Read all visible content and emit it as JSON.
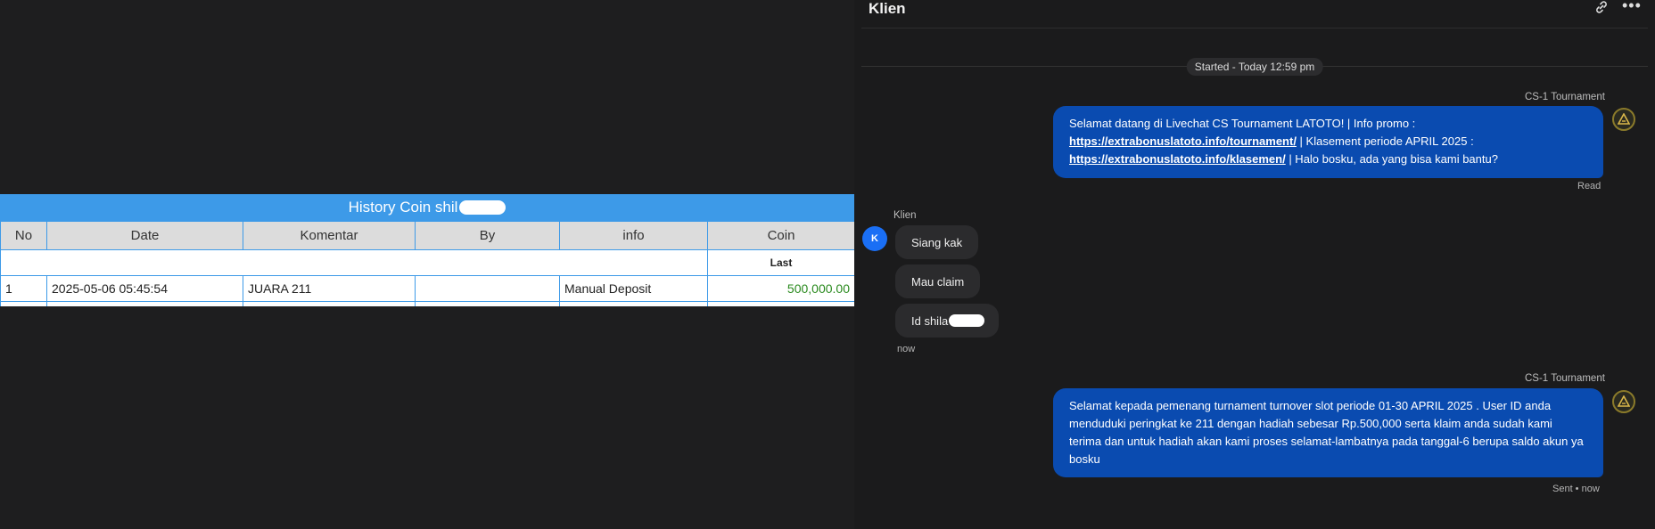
{
  "history": {
    "title": "History Coin shil",
    "columns": [
      "No",
      "Date",
      "Komentar",
      "By",
      "info",
      "Coin"
    ],
    "subheader_last": "Last",
    "rows": [
      {
        "no": "1",
        "date": "2025-05-06 05:45:54",
        "komentar": "JUARA 211",
        "by": "",
        "info": "Manual Deposit",
        "coin": "500,000.00"
      }
    ]
  },
  "chat": {
    "contact_name": "Klien",
    "started_label": "Started - Today 12:59 pm",
    "agent_name": "CS-1 Tournament",
    "message1": {
      "part1": "Selamat datang di Livechat CS Tournament LATOTO! | Info promo :",
      "link1": "https://extrabonuslatoto.info/tournament/",
      "part2": " | Klasement periode APRIL 2025 :",
      "link2": "https://extrabonuslatoto.info/klasemen/",
      "part3": " | Halo bosku, ada yang bisa kami bantu?",
      "status": "Read"
    },
    "client_label": "Klien",
    "client_avatar_letter": "K",
    "client_messages": [
      "Siang kak",
      "Mau claim",
      "Id shila"
    ],
    "client_time": "now",
    "agent_name2": "CS-1 Tournament",
    "message2": {
      "text": "Selamat kepada pemenang turnament turnover slot periode 01-30 APRIL 2025 . User ID anda menduduki peringkat ke 211 dengan hadiah sebesar Rp.500,000 serta klaim anda sudah kami terima dan untuk hadiah akan kami proses selamat-lambatnya pada tanggal-6 berupa saldo akun ya bosku",
      "status": "Sent • now"
    }
  },
  "colors": {
    "table_header_blue": "#3d9ae8",
    "coin_green": "#2a8a1e",
    "outgoing_bubble": "#0a4bb0",
    "incoming_bubble": "#2b2b2d",
    "avatar_blue": "#1a6ff5"
  },
  "icons": [
    "link-icon",
    "more-icon",
    "bot-avatar-icon"
  ]
}
